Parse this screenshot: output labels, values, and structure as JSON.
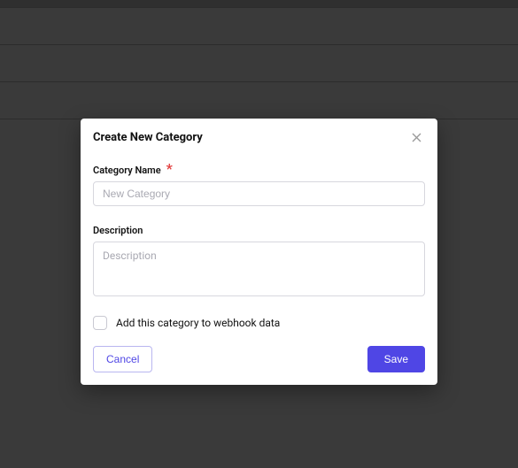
{
  "modal": {
    "title": "Create New Category",
    "categoryName": {
      "label": "Category Name",
      "requiredMark": "*",
      "placeholder": "New Category",
      "value": ""
    },
    "description": {
      "label": "Description",
      "placeholder": "Description",
      "value": ""
    },
    "webhookCheckbox": {
      "label": "Add this category to webhook data",
      "checked": false
    },
    "buttons": {
      "cancel": "Cancel",
      "save": "Save"
    }
  },
  "colors": {
    "primary": "#4f46e5",
    "danger": "#e23d3d"
  }
}
